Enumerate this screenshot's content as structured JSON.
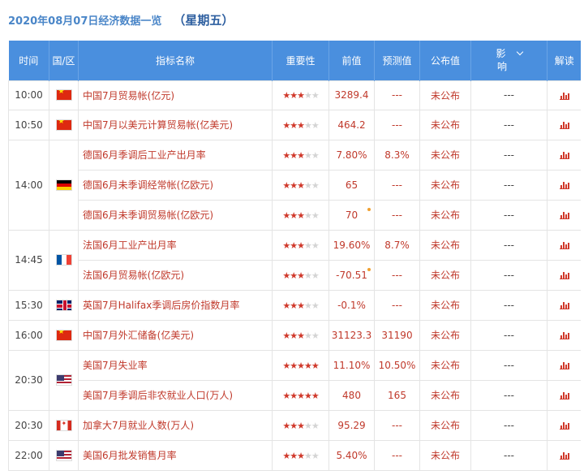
{
  "header": {
    "date_title": "2020年08月07日经济数据一览",
    "weekday": "（星期五）"
  },
  "columns": {
    "time": "时间",
    "region": "国/区",
    "name": "指标名称",
    "importance": "重要性",
    "previous": "前值",
    "forecast": "预测值",
    "actual": "公布值",
    "effect_top": "影",
    "effect_bottom": "响",
    "detail": "解读"
  },
  "colors": {
    "header_bg": "#4a8fde",
    "value_text": "#c0392b",
    "star_on": "#d0392b",
    "star_off": "#d4d4d4"
  },
  "rows": [
    {
      "time": "10:00",
      "flag": "cn-flag-icon",
      "name": "中国7月贸易帐(亿元)",
      "stars": 3,
      "previous": "3289.4",
      "forecast": "---",
      "actual": "未公布",
      "effect": "---",
      "revised": false
    },
    {
      "time": "10:50",
      "flag": "cn-flag-icon",
      "name": "中国7月以美元计算贸易帐(亿美元)",
      "stars": 3,
      "previous": "464.2",
      "forecast": "---",
      "actual": "未公布",
      "effect": "---",
      "revised": false
    },
    {
      "time": "14:00",
      "flag": "de-flag-icon",
      "name": "德国6月季调后工业产出月率",
      "stars": 3,
      "previous": "7.80%",
      "forecast": "8.3%",
      "actual": "未公布",
      "effect": "---",
      "revised": false
    },
    {
      "time": "",
      "flag": "",
      "name": "德国6月未季调经常帐(亿欧元)",
      "stars": 3,
      "previous": "65",
      "forecast": "---",
      "actual": "未公布",
      "effect": "---",
      "revised": false
    },
    {
      "time": "",
      "flag": "",
      "name": "德国6月未季调贸易帐(亿欧元)",
      "stars": 3,
      "previous": "70",
      "forecast": "---",
      "actual": "未公布",
      "effect": "---",
      "revised": true
    },
    {
      "time": "14:45",
      "flag": "fr-flag-icon",
      "name": "法国6月工业产出月率",
      "stars": 3,
      "previous": "19.60%",
      "forecast": "8.7%",
      "actual": "未公布",
      "effect": "---",
      "revised": false
    },
    {
      "time": "",
      "flag": "",
      "name": "法国6月贸易帐(亿欧元)",
      "stars": 3,
      "previous": "-70.51",
      "forecast": "---",
      "actual": "未公布",
      "effect": "---",
      "revised": true
    },
    {
      "time": "15:30",
      "flag": "gb-flag-icon",
      "name": "英国7月Halifax季调后房价指数月率",
      "stars": 3,
      "previous": "-0.1%",
      "forecast": "---",
      "actual": "未公布",
      "effect": "---",
      "revised": false
    },
    {
      "time": "16:00",
      "flag": "cn-flag-icon",
      "name": "中国7月外汇储备(亿美元)",
      "stars": 3,
      "previous": "31123.3",
      "forecast": "31190",
      "actual": "未公布",
      "effect": "---",
      "revised": false
    },
    {
      "time": "20:30",
      "flag": "us-flag-icon",
      "name": "美国7月失业率",
      "stars": 5,
      "previous": "11.10%",
      "forecast": "10.50%",
      "actual": "未公布",
      "effect": "---",
      "revised": false
    },
    {
      "time": "",
      "flag": "",
      "name": "美国7月季调后非农就业人口(万人)",
      "stars": 5,
      "previous": "480",
      "forecast": "165",
      "actual": "未公布",
      "effect": "---",
      "revised": false
    },
    {
      "time": "20:30",
      "flag": "ca-flag-icon",
      "name": "加拿大7月就业人数(万人)",
      "stars": 3,
      "previous": "95.29",
      "forecast": "---",
      "actual": "未公布",
      "effect": "---",
      "revised": false
    },
    {
      "time": "22:00",
      "flag": "us-flag-icon",
      "name": "美国6月批发销售月率",
      "stars": 3,
      "previous": "5.40%",
      "forecast": "---",
      "actual": "未公布",
      "effect": "---",
      "revised": false
    }
  ]
}
